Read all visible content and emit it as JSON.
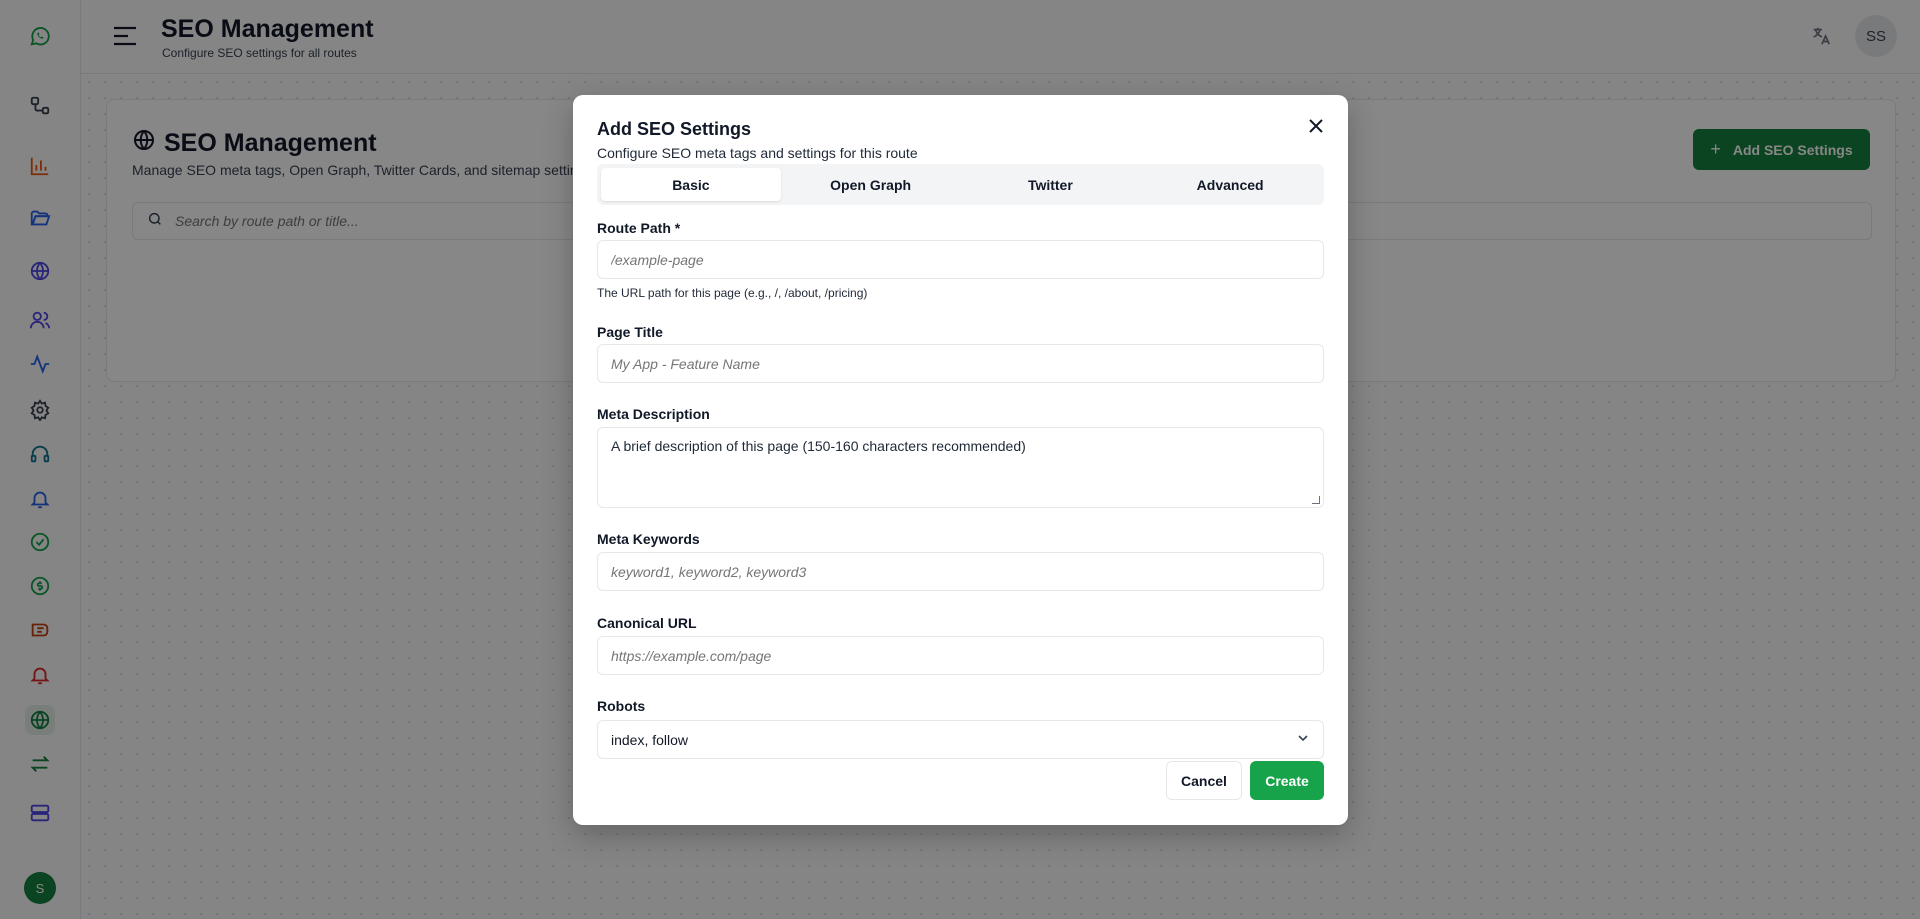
{
  "header": {
    "title": "SEO Management",
    "subtitle": "Configure SEO settings for all routes",
    "user_initials": "SS"
  },
  "sidebar": {
    "user_initial": "S",
    "items": [
      {
        "icon": "whatsapp-icon",
        "color": "#16a34a"
      },
      {
        "icon": "workflow-icon",
        "color": "#374151"
      },
      {
        "icon": "bar-chart-icon",
        "color": "#ea580c"
      },
      {
        "icon": "folder-open-icon",
        "color": "#2563eb"
      },
      {
        "icon": "globe-icon",
        "color": "#4f46e5"
      },
      {
        "icon": "users-icon",
        "color": "#4f46e5"
      },
      {
        "icon": "activity-icon",
        "color": "#2563eb"
      },
      {
        "icon": "settings-icon",
        "color": "#374151"
      },
      {
        "icon": "headset-icon",
        "color": "#0e7490"
      },
      {
        "icon": "bell-icon",
        "color": "#2563eb"
      },
      {
        "icon": "check-circle-icon",
        "color": "#16a34a"
      },
      {
        "icon": "currency-exchange-icon",
        "color": "#16a34a"
      },
      {
        "icon": "badge-icon",
        "color": "#c2410c"
      },
      {
        "icon": "bell-alert-icon",
        "color": "#dc2626"
      },
      {
        "icon": "globe-active-icon",
        "color": "#15803d"
      },
      {
        "icon": "arrows-exchange-icon",
        "color": "#15803d"
      },
      {
        "icon": "server-icon",
        "color": "#4f46e5"
      }
    ]
  },
  "page": {
    "title": "SEO Management",
    "description": "Manage SEO meta tags, Open Graph, Twitter Cards, and sitemap settings",
    "add_button": "Add SEO Settings",
    "search_placeholder": "Search by route path or title..."
  },
  "modal": {
    "title": "Add SEO Settings",
    "subtitle": "Configure SEO meta tags and settings for this route",
    "tabs": [
      "Basic",
      "Open Graph",
      "Twitter",
      "Advanced"
    ],
    "active_tab": "Basic",
    "route_path": {
      "label": "Route Path *",
      "placeholder": "/example-page",
      "hint": "The URL path for this page (e.g., /, /about, /pricing)"
    },
    "page_title": {
      "label": "Page Title",
      "placeholder": "My App - Feature Name"
    },
    "meta_description": {
      "label": "Meta Description",
      "value": "A brief description of this page (150-160 characters recommended)"
    },
    "meta_keywords": {
      "label": "Meta Keywords",
      "placeholder": "keyword1, keyword2, keyword3"
    },
    "canonical_url": {
      "label": "Canonical URL",
      "placeholder": "https://example.com/page"
    },
    "robots": {
      "label": "Robots",
      "value": "index, follow"
    },
    "cancel": "Cancel",
    "create": "Create"
  },
  "colors": {
    "primary": "#15803d",
    "create": "#16a34a"
  }
}
